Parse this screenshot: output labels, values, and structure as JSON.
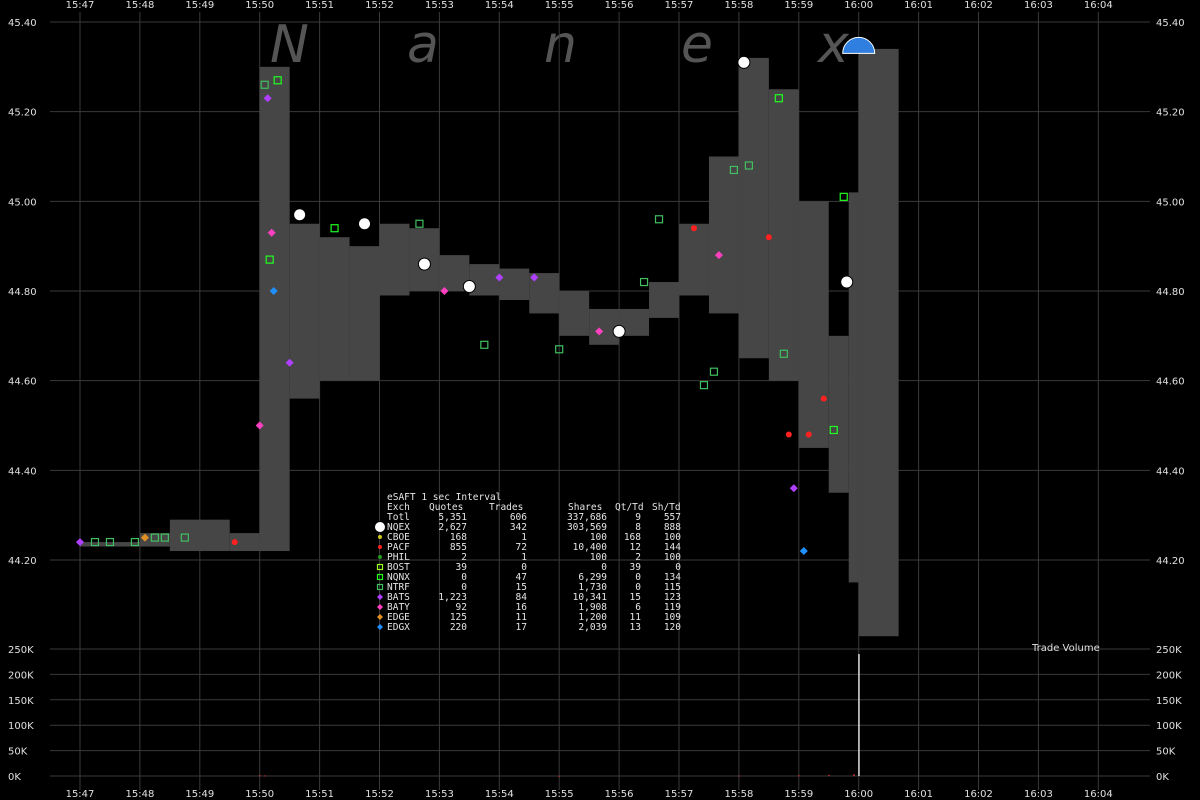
{
  "chart_data": [
    {
      "type": "scatter",
      "title": "eSAFT 1 sec Interval",
      "watermark": [
        "N",
        "a",
        "n",
        "e",
        "x"
      ],
      "x_ticks": [
        "15:47",
        "15:48",
        "15:49",
        "15:50",
        "15:51",
        "15:52",
        "15:53",
        "15:54",
        "15:55",
        "15:56",
        "15:57",
        "15:58",
        "15:59",
        "16:00",
        "16:01",
        "16:02",
        "16:03",
        "16:04"
      ],
      "y_ticks": [
        "45.40",
        "45.20",
        "45.00",
        "44.80",
        "44.60",
        "44.40",
        "44.20"
      ],
      "ylim": [
        44.1,
        45.4
      ],
      "grid": true,
      "nbbo_band": [
        {
          "t": "15:47:00",
          "low": 44.23,
          "high": 44.24
        },
        {
          "t": "15:48:00",
          "low": 44.23,
          "high": 44.26
        },
        {
          "t": "15:48:30",
          "low": 44.22,
          "high": 44.29
        },
        {
          "t": "15:49:30",
          "low": 44.22,
          "high": 44.26
        },
        {
          "t": "15:50:00",
          "low": 44.22,
          "high": 45.3
        },
        {
          "t": "15:50:30",
          "low": 44.56,
          "high": 44.95
        },
        {
          "t": "15:51:00",
          "low": 44.6,
          "high": 44.92
        },
        {
          "t": "15:51:30",
          "low": 44.6,
          "high": 44.9
        },
        {
          "t": "15:52:00",
          "low": 44.79,
          "high": 44.95
        },
        {
          "t": "15:52:30",
          "low": 44.8,
          "high": 44.94
        },
        {
          "t": "15:53:00",
          "low": 44.8,
          "high": 44.88
        },
        {
          "t": "15:53:30",
          "low": 44.79,
          "high": 44.86
        },
        {
          "t": "15:54:00",
          "low": 44.78,
          "high": 44.85
        },
        {
          "t": "15:54:30",
          "low": 44.75,
          "high": 44.84
        },
        {
          "t": "15:55:00",
          "low": 44.7,
          "high": 44.8
        },
        {
          "t": "15:55:30",
          "low": 44.68,
          "high": 44.76
        },
        {
          "t": "15:56:00",
          "low": 44.7,
          "high": 44.76
        },
        {
          "t": "15:56:30",
          "low": 44.74,
          "high": 44.82
        },
        {
          "t": "15:57:00",
          "low": 44.79,
          "high": 44.95
        },
        {
          "t": "15:57:30",
          "low": 44.75,
          "high": 45.1
        },
        {
          "t": "15:58:00",
          "low": 44.65,
          "high": 45.32
        },
        {
          "t": "15:58:30",
          "low": 44.6,
          "high": 45.25
        },
        {
          "t": "15:59:00",
          "low": 44.45,
          "high": 45.0
        },
        {
          "t": "15:59:30",
          "low": 44.35,
          "high": 44.7
        },
        {
          "t": "15:59:50",
          "low": 44.15,
          "high": 45.02
        },
        {
          "t": "16:00:00",
          "low": 44.03,
          "high": 45.34
        },
        {
          "t": "16:00:40",
          "low": 44.03,
          "high": 45.34
        }
      ],
      "trades": [
        {
          "t": "15:47:00",
          "p": 44.24,
          "exch": "BATS"
        },
        {
          "t": "15:47:15",
          "p": 44.24,
          "exch": "NTRF"
        },
        {
          "t": "15:47:30",
          "p": 44.24,
          "exch": "NTRF"
        },
        {
          "t": "15:47:55",
          "p": 44.24,
          "exch": "NTRF"
        },
        {
          "t": "15:48:05",
          "p": 44.25,
          "exch": "EDGE"
        },
        {
          "t": "15:48:15",
          "p": 44.25,
          "exch": "NTRF"
        },
        {
          "t": "15:48:25",
          "p": 44.25,
          "exch": "NTRF"
        },
        {
          "t": "15:48:45",
          "p": 44.25,
          "exch": "NTRF"
        },
        {
          "t": "15:49:35",
          "p": 44.24,
          "exch": "PACF"
        },
        {
          "t": "15:50:00",
          "p": 44.5,
          "exch": "BATY"
        },
        {
          "t": "15:50:05",
          "p": 45.26,
          "exch": "NTRF"
        },
        {
          "t": "15:50:08",
          "p": 45.23,
          "exch": "BATS"
        },
        {
          "t": "15:50:10",
          "p": 44.87,
          "exch": "NQNX"
        },
        {
          "t": "15:50:12",
          "p": 44.93,
          "exch": "BATY"
        },
        {
          "t": "15:50:14",
          "p": 44.8,
          "exch": "EDGX"
        },
        {
          "t": "15:50:18",
          "p": 45.27,
          "exch": "NQNX"
        },
        {
          "t": "15:50:30",
          "p": 44.64,
          "exch": "BATS"
        },
        {
          "t": "15:50:40",
          "p": 44.97,
          "exch": "NQEX"
        },
        {
          "t": "15:51:15",
          "p": 44.94,
          "exch": "NQNX"
        },
        {
          "t": "15:51:45",
          "p": 44.95,
          "exch": "NQEX"
        },
        {
          "t": "15:52:40",
          "p": 44.95,
          "exch": "NTRF"
        },
        {
          "t": "15:52:45",
          "p": 44.86,
          "exch": "NQEX"
        },
        {
          "t": "15:53:05",
          "p": 44.8,
          "exch": "BATY"
        },
        {
          "t": "15:53:30",
          "p": 44.81,
          "exch": "NQEX"
        },
        {
          "t": "15:53:45",
          "p": 44.68,
          "exch": "NTRF"
        },
        {
          "t": "15:54:00",
          "p": 44.83,
          "exch": "BATS"
        },
        {
          "t": "15:54:35",
          "p": 44.83,
          "exch": "BATS"
        },
        {
          "t": "15:55:00",
          "p": 44.67,
          "exch": "NTRF"
        },
        {
          "t": "15:55:40",
          "p": 44.71,
          "exch": "BATY"
        },
        {
          "t": "15:56:00",
          "p": 44.71,
          "exch": "NQEX"
        },
        {
          "t": "15:56:25",
          "p": 44.82,
          "exch": "NTRF"
        },
        {
          "t": "15:56:40",
          "p": 44.96,
          "exch": "NTRF"
        },
        {
          "t": "15:57:15",
          "p": 44.94,
          "exch": "PACF"
        },
        {
          "t": "15:57:25",
          "p": 44.59,
          "exch": "NTRF"
        },
        {
          "t": "15:57:35",
          "p": 44.62,
          "exch": "NTRF"
        },
        {
          "t": "15:57:40",
          "p": 44.88,
          "exch": "BATY"
        },
        {
          "t": "15:57:55",
          "p": 45.07,
          "exch": "NTRF"
        },
        {
          "t": "15:58:05",
          "p": 45.31,
          "exch": "NQEX"
        },
        {
          "t": "15:58:10",
          "p": 45.08,
          "exch": "NTRF"
        },
        {
          "t": "15:58:30",
          "p": 44.92,
          "exch": "PACF"
        },
        {
          "t": "15:58:40",
          "p": 45.23,
          "exch": "NQNX"
        },
        {
          "t": "15:58:45",
          "p": 44.66,
          "exch": "NTRF"
        },
        {
          "t": "15:58:50",
          "p": 44.48,
          "exch": "PACF"
        },
        {
          "t": "15:58:55",
          "p": 44.36,
          "exch": "BATS"
        },
        {
          "t": "15:59:05",
          "p": 44.22,
          "exch": "EDGX"
        },
        {
          "t": "15:59:10",
          "p": 44.48,
          "exch": "PACF"
        },
        {
          "t": "15:59:25",
          "p": 44.56,
          "exch": "PACF"
        },
        {
          "t": "15:59:35",
          "p": 44.49,
          "exch": "NQNX"
        },
        {
          "t": "15:59:45",
          "p": 45.01,
          "exch": "NQNX"
        },
        {
          "t": "15:59:48",
          "p": 44.82,
          "exch": "NQEX"
        },
        {
          "t": "16:00:00",
          "p": 45.35,
          "exch": "NQEX"
        }
      ],
      "legend": {
        "title": "eSAFT 1 sec Interval",
        "header": [
          "Exch",
          "Quotes",
          "Trades",
          "Shares",
          "Qt/Td",
          "Sh/Td"
        ],
        "rows": [
          {
            "exch": "Totl",
            "quotes": "5,351",
            "trades": "606",
            "shares": "337,686",
            "qt_td": "9",
            "sh_td": "557",
            "color": "",
            "marker": "none"
          },
          {
            "exch": "NQEX",
            "quotes": "2,627",
            "trades": "342",
            "shares": "303,569",
            "qt_td": "8",
            "sh_td": "888",
            "color": "#ffffff",
            "marker": "circle-big"
          },
          {
            "exch": "CBOE",
            "quotes": "168",
            "trades": "1",
            "shares": "100",
            "qt_td": "168",
            "sh_td": "100",
            "color": "#c8c820",
            "marker": "circle"
          },
          {
            "exch": "PACF",
            "quotes": "855",
            "trades": "72",
            "shares": "10,400",
            "qt_td": "12",
            "sh_td": "144",
            "color": "#ff2020",
            "marker": "circle"
          },
          {
            "exch": "PHIL",
            "quotes": "2",
            "trades": "1",
            "shares": "100",
            "qt_td": "2",
            "sh_td": "100",
            "color": "#20a020",
            "marker": "circle"
          },
          {
            "exch": "BOST",
            "quotes": "39",
            "trades": "0",
            "shares": "0",
            "qt_td": "39",
            "sh_td": "0",
            "color": "#a0ff20",
            "marker": "square"
          },
          {
            "exch": "NQNX",
            "quotes": "0",
            "trades": "47",
            "shares": "6,299",
            "qt_td": "0",
            "sh_td": "134",
            "color": "#20ff20",
            "marker": "square"
          },
          {
            "exch": "NTRF",
            "quotes": "0",
            "trades": "15",
            "shares": "1,730",
            "qt_td": "0",
            "sh_td": "115",
            "color": "#40c060",
            "marker": "square"
          },
          {
            "exch": "BATS",
            "quotes": "1,223",
            "trades": "84",
            "shares": "10,341",
            "qt_td": "15",
            "sh_td": "123",
            "color": "#b040ff",
            "marker": "diamond"
          },
          {
            "exch": "BATY",
            "quotes": "92",
            "trades": "16",
            "shares": "1,908",
            "qt_td": "6",
            "sh_td": "119",
            "color": "#ff40c0",
            "marker": "diamond"
          },
          {
            "exch": "EDGE",
            "quotes": "125",
            "trades": "11",
            "shares": "1,200",
            "qt_td": "11",
            "sh_td": "109",
            "color": "#e09020",
            "marker": "diamond"
          },
          {
            "exch": "EDGX",
            "quotes": "220",
            "trades": "17",
            "shares": "2,039",
            "qt_td": "13",
            "sh_td": "120",
            "color": "#2090ff",
            "marker": "diamond"
          }
        ]
      }
    },
    {
      "type": "bar",
      "title": "Trade Volume",
      "y_ticks": [
        "250K",
        "200K",
        "150K",
        "100K",
        "50K",
        "0K"
      ],
      "ylim": [
        0,
        250000
      ],
      "x_ticks": [
        "15:47",
        "15:48",
        "15:49",
        "15:50",
        "15:51",
        "15:52",
        "15:53",
        "15:54",
        "15:55",
        "15:56",
        "15:57",
        "15:58",
        "15:59",
        "16:00",
        "16:01",
        "16:02",
        "16:03",
        "16:04"
      ],
      "bars": [
        {
          "t": "15:50:00",
          "v": 1500
        },
        {
          "t": "15:50:05",
          "v": 1200
        },
        {
          "t": "15:55:00",
          "v": 500
        },
        {
          "t": "15:58:00",
          "v": 900
        },
        {
          "t": "15:59:00",
          "v": 1400
        },
        {
          "t": "15:59:30",
          "v": 2200
        },
        {
          "t": "15:59:55",
          "v": 3500
        },
        {
          "t": "16:00:00",
          "v": 240000
        }
      ]
    }
  ]
}
